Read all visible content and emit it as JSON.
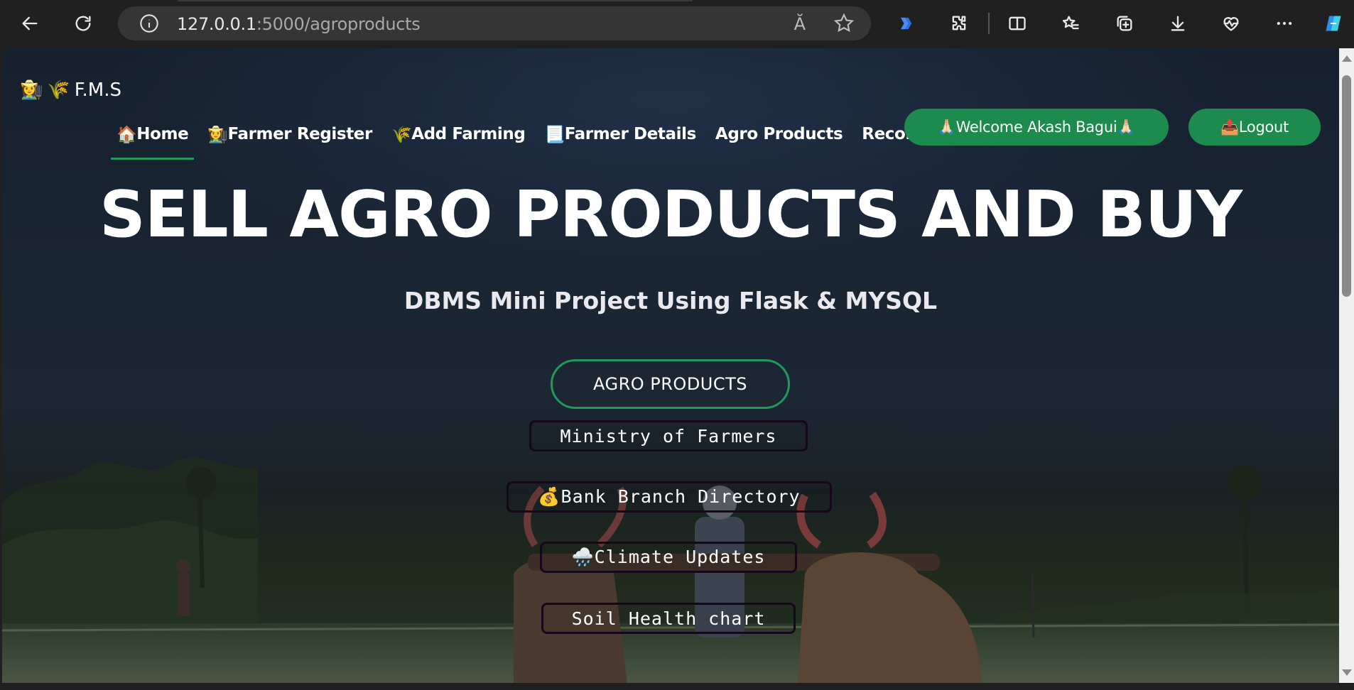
{
  "browser": {
    "url_host": "127.0.0.1",
    "url_rest": ":5000/agroproducts",
    "read_aloud": "Ă"
  },
  "site": {
    "brand": "F.M.S",
    "nav": [
      {
        "icon": "🏠",
        "label": "Home"
      },
      {
        "icon": "👩‍🌾",
        "label": "Farmer Register"
      },
      {
        "icon": "🌾",
        "label": "Add Farming"
      },
      {
        "icon": "📃",
        "label": "Farmer Details"
      },
      {
        "icon": "",
        "label": "Agro Products"
      },
      {
        "icon": "",
        "label": "Records"
      }
    ],
    "welcome": "🙏🏻Welcome Akash Bagui🙏🏻",
    "logout": "📤Logout"
  },
  "hero": {
    "title": "SELL AGRO PRODUCTS AND BUY",
    "subtitle": "DBMS Mini Project Using Flask & MYSQL",
    "cta": "AGRO PRODUCTS",
    "links": [
      "Ministry of Farmers",
      "💰Bank Branch Directory",
      "🌧️Climate Updates",
      "Soil Health chart"
    ]
  },
  "colors": {
    "accent_green": "#1e8b4e",
    "underline_green": "#1e9a5a"
  }
}
